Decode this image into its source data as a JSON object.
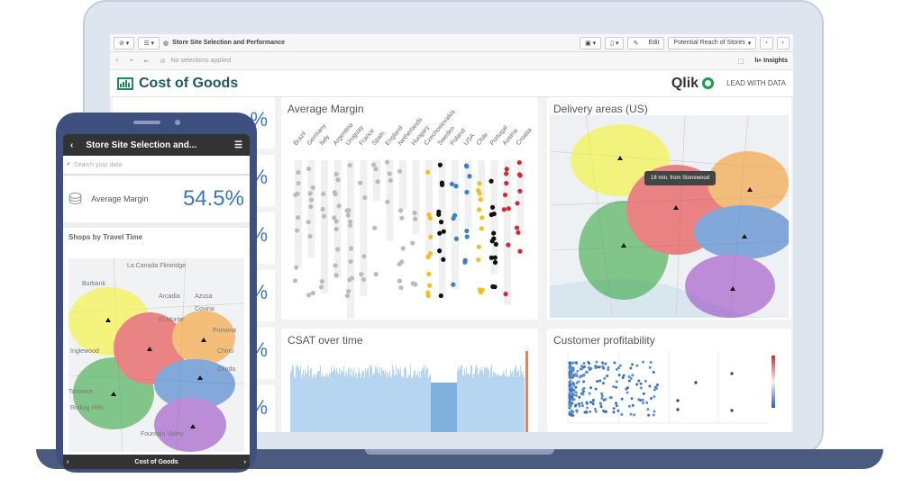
{
  "app": {
    "title": "Store Site Selection and Performance",
    "edit": "Edit",
    "sheet": "Potential Reach of Stores",
    "no_selections": "No selections applied",
    "insights": "Insights"
  },
  "header": {
    "title": "Cost of Goods",
    "brand": "Qlik",
    "tagline": "LEAD WITH DATA"
  },
  "kpis": [
    "%",
    "%",
    "%",
    "%",
    "%",
    "%"
  ],
  "avg_margin": {
    "title": "Average Margin",
    "countries": [
      "Brazil",
      "Germany",
      "Italy",
      "Argentina",
      "Uruguay",
      "France",
      "Spain",
      "England",
      "Netherlands",
      "Hungary",
      "Czechoslovakia",
      "Sweden",
      "Poland",
      "USA",
      "Chile",
      "Portugal",
      "Austria",
      "Croatia"
    ]
  },
  "delivery": {
    "title": "Delivery areas (US)",
    "tooltip": "18 min. from Stonewood"
  },
  "csat": {
    "title": "CSAT over time"
  },
  "profit": {
    "title": "Customer profitability"
  },
  "phone": {
    "title": "Store Site Selection and...",
    "search_placeholder": "Search your data",
    "kpi_label": "Average Margin",
    "kpi_value": "54.5%",
    "map_title": "Shops by Travel Time",
    "footer": "Cost of Goods",
    "places": [
      "Burbank",
      "La Canada Flintridge",
      "Arcadia",
      "Azusa",
      "Covina",
      "El Monte",
      "Pomona",
      "Inglewood",
      "Chino",
      "Olinda",
      "Torrance",
      "Rolling Hills",
      "Fountain Valley"
    ]
  },
  "colors": {
    "accent": "#3a78b7",
    "brand": "#1f5a5a",
    "device": "#3d5080"
  }
}
